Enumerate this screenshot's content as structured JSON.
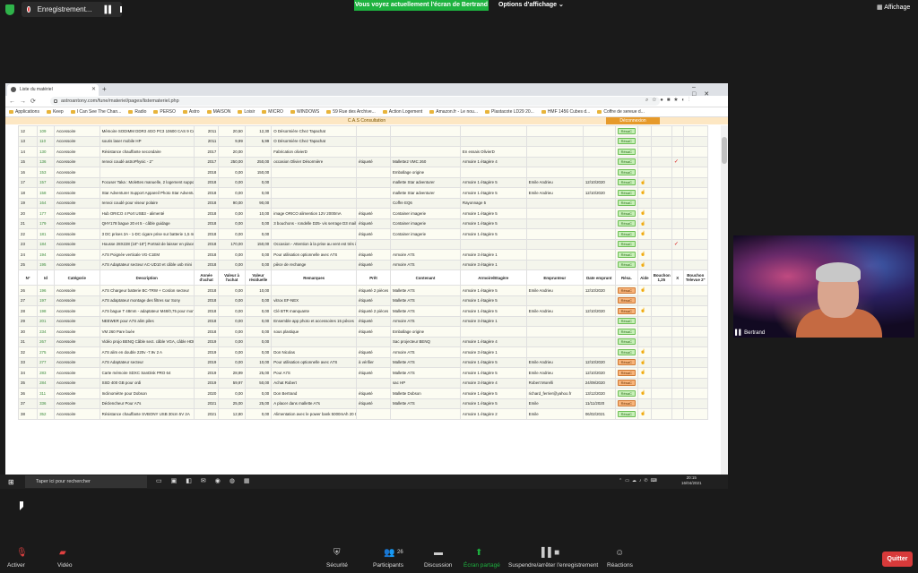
{
  "zoom": {
    "recording_label": "Enregistrement...",
    "share_banner": "Vous voyez actuellement l'écran de Bertrand",
    "view_options": "Options d'affichage ⌄",
    "display_label": "Affichage",
    "participant_name": "Bertrand",
    "participants_count": "26",
    "controls": {
      "mute": "Activer",
      "video": "Vidéo",
      "security": "Sécurité",
      "participants": "Participants",
      "chat": "Discussion",
      "share": "Écran partagé",
      "pause_share": "Suspendre/arrêter l'enregistrement",
      "reactions": "Réactions",
      "quit": "Quitter"
    }
  },
  "browser": {
    "tab_title": "Liste du matériel",
    "url": "astroantony.com/fune/materiel/pages/listemateriel.php",
    "bookmarks": [
      "Applications",
      "Keep",
      "I Can See The Chan...",
      "Radio",
      "PERSO",
      "Astro",
      "MAISON",
      "Loisir",
      "MICRO",
      "WINDOWS",
      "59 Rue des Archive...",
      "Action Logement",
      "Amazon.fr - Le nou...",
      "Plastacote LD29 20...",
      "HMF 1456 Cubes d...",
      "Coffre de sereue d..."
    ]
  },
  "page": {
    "title": "C.A.S Consultation",
    "disconnect": "Déconnexion",
    "headers": [
      "N°",
      "Id",
      "Catégorie",
      "Description",
      "Année d'achat",
      "Valeur à l'achat",
      "Valeur résiduelle",
      "Remarques",
      "Prêt",
      "Contenant",
      "Armoire/Etagère",
      "Emprunteur",
      "Date emprunt",
      "Résa.",
      "Aide",
      "Bouchon 1,25",
      "X",
      "Bouchon Televue 2\""
    ],
    "resa_label": "RésaC",
    "rows_top": [
      [
        "12",
        "109",
        "Accessoire",
        "Mémoire SODIMM DDR3 4GO PC3 10600 CAS 9 Crucial",
        "2011",
        "20,50",
        "12,30",
        "O Désormière Chez Tapachat",
        "",
        "",
        "",
        "",
        "",
        "g",
        "",
        "",
        "",
        ""
      ],
      [
        "13",
        "110",
        "Accessoire",
        "souris laser mobile HP",
        "2011",
        "9,99",
        "5,99",
        "O Désormière Chez Tapachat",
        "",
        "",
        "",
        "",
        "",
        "g",
        "",
        "",
        "",
        ""
      ],
      [
        "14",
        "130",
        "Accessoire",
        "Résistance chauffante secondaire",
        "2017",
        "20,00",
        "",
        "Fabrication olivierD",
        "",
        "",
        "En essais OlivierD",
        "",
        "",
        "g",
        "",
        "",
        "",
        ""
      ],
      [
        "15",
        "136",
        "Accessoire",
        "renvoi coudé astroPhysic - 2\"",
        "2017",
        "250,00",
        "250,00",
        "occasion Olivier Désormière",
        "étiqueté",
        "Mallette2 VMC 260",
        "Armoire 1 étagère 4",
        "",
        "",
        "g",
        "",
        "",
        "✓",
        ""
      ],
      [
        "16",
        "153",
        "Accessoire",
        "",
        "2018",
        "0,00",
        "150,00",
        "",
        "",
        "Emballage origine",
        "",
        "",
        "",
        "g",
        "",
        "",
        "",
        ""
      ],
      [
        "17",
        "157",
        "Accessoire",
        "Focuser Taka : Molettes manuelle, 2 logement supports, clés Allen",
        "2018",
        "0,00",
        "0,00",
        "",
        "",
        "mallette Star adventurer",
        "Armoire 1 étagère 5",
        "Emile Andrieu",
        "12/10/2020",
        "g",
        "h",
        "",
        "",
        ""
      ],
      [
        "18",
        "158",
        "Accessoire",
        "Star Adventurer Support Appareil Photo Star Adventurer Accessoires tige et un Contrepoids, 9 pièces + clé Allen",
        "2018",
        "0,00",
        "0,00",
        "",
        "",
        "mallette Star adventurer",
        "Armoire 1 étagère 5",
        "Emile Andrieu",
        "12/10/2020",
        "g",
        "h",
        "",
        "",
        ""
      ],
      [
        "19",
        "164",
        "Accessoire",
        "renvoi coudé pour viseur polaire",
        "2018",
        "90,00",
        "90,00",
        "",
        "",
        "Coffre EQ6",
        "Rayonnage 5",
        "",
        "",
        "g",
        "",
        "",
        "",
        ""
      ],
      [
        "20",
        "177",
        "Accessoire",
        "Hub ORICO 4 Port USB3 - alimenté",
        "2018",
        "0,00",
        "10,00",
        "image ORICO alimention 12V 2000mA",
        "étiqueté",
        "Container imagerie",
        "Armoire 1 étagère 5",
        "",
        "",
        "g",
        "h",
        "",
        "",
        ""
      ],
      [
        "21",
        "179",
        "Accessoire",
        "QHY178 bague 20 et 5 - câble guidage",
        "2018",
        "0,00",
        "0,00",
        "3 bouchons - rondelle D25- vis serrage D3 maille-2 bagues",
        "étiqueté",
        "Container imagerie",
        "Armoire 1 étagère 5",
        "",
        "",
        "g",
        "h",
        "",
        "",
        ""
      ],
      [
        "22",
        "181",
        "Accessoire",
        "3 DC prises 2A - 1-DC cigare prise sur batterie 1,5 mètre",
        "2018",
        "0,00",
        "0,00",
        "",
        "étiqueté",
        "Container imagerie",
        "Armoire 1 étagère 5",
        "",
        "",
        "g",
        "h",
        "",
        "",
        ""
      ],
      [
        "23",
        "184",
        "Accessoire",
        "Housse 28X228 (18\"-18\") Portrait de laisser en place monture et Tube",
        "2018",
        "170,00",
        "150,00",
        "Occasion - Attention à la prise au vent est très importante",
        "",
        "",
        "",
        "",
        "",
        "g",
        "",
        "",
        "✓",
        ""
      ],
      [
        "24",
        "194",
        "Accessoire",
        "A7S Poignée verticale VG-C1EM",
        "2018",
        "0,00",
        "0,00",
        "Pour utilisation optionnelle avec A7S",
        "étiqueté",
        "Armoire A7S",
        "Armoire 3 étagère 1",
        "",
        "",
        "g",
        "h",
        "",
        "",
        ""
      ],
      [
        "25",
        "195",
        "Accessoire",
        "A7S Adaptateur secteur AC-UD10 et câble usb mini",
        "2018",
        "0,00",
        "0,00",
        "pièce de rechange",
        "étiqueté",
        "Armoire A7S",
        "Armoire 3 étagère 1",
        "",
        "",
        "g",
        "h",
        "",
        "",
        ""
      ]
    ],
    "rows_bottom": [
      [
        "26",
        "196",
        "Accessoire",
        "A7S Chargeur batterie BC-TRW + Cordon secteur",
        "2018",
        "0,00",
        "10,00",
        "",
        "étiqueté 2 pièces",
        "Mallette A7S",
        "Armoire 1 étagère 5",
        "Emile Andrieu",
        "12/10/2020",
        "o",
        "h",
        "",
        "",
        ""
      ],
      [
        "27",
        "197",
        "Accessoire",
        "A7S adaptateur montage des filtres sur Sony",
        "2018",
        "0,00",
        "0,00",
        "vitrox EF-NEX",
        "étiqueté",
        "Mallette A7S",
        "Armoire 1 étagère 5",
        "",
        "",
        "o",
        "",
        "",
        "",
        ""
      ],
      [
        "28",
        "198",
        "Accessoire",
        "A7S bague T 48mm - adaptateur M48/0,75 pour montage télescope + clé BTR",
        "2018",
        "0,00",
        "0,00",
        "Clé BTR manquante",
        "étiqueté 2 pièces",
        "Mallette A7S",
        "Armoire 1 étagère 5",
        "Emile Andrieu",
        "12/10/2020",
        "o",
        "h",
        "",
        "",
        ""
      ],
      [
        "29",
        "201",
        "Accessoire",
        "NEEWER pour A7S alim piles",
        "2018",
        "0,00",
        "0,00",
        "Ensemble app photo et accessoires 15 pièces",
        "étiqueté",
        "Armoire A7S",
        "Armoire 3 étagère 1",
        "",
        "",
        "g",
        "",
        "",
        "",
        ""
      ],
      [
        "30",
        "234",
        "Accessoire",
        "VM 260 Pare buée",
        "2018",
        "0,00",
        "0,00",
        "sous plastique",
        "étiqueté",
        "Emballage origine",
        "",
        "",
        "",
        "g",
        "",
        "",
        "",
        ""
      ],
      [
        "31",
        "267",
        "Accessoire",
        "Vidéo projo BENQ Câble sect. câble VGA, câble HDMI, télécommande pointeur laser",
        "2019",
        "0,00",
        "0,00",
        "",
        "",
        "Sac projecteur BENQ",
        "Armoire 1 étagère 4",
        "",
        "",
        "g",
        "",
        "",
        "",
        ""
      ],
      [
        "32",
        "275",
        "Accessoire",
        "A7S alim en double 220v -7.9v 2 A",
        "2019",
        "0,00",
        "0,00",
        "Don Nicolas",
        "étiqueté",
        "Armoire A7S",
        "Armoire 3 étagère 1",
        "",
        "",
        "g",
        "h",
        "",
        "",
        ""
      ],
      [
        "33",
        "277",
        "Accessoire",
        "A7S Adaptateur secteur",
        "2019",
        "0,00",
        "10,00",
        "Pour utilisation optionnelle avec A7S",
        "à vérifier",
        "Mallette A7S",
        "Armoire 1 étagère 5",
        "Emile Andrieu",
        "12/10/2020",
        "o",
        "h",
        "",
        "",
        ""
      ],
      [
        "34",
        "283",
        "Accessoire",
        "Carte mémoire SDXC SanDisk PRO 64",
        "2019",
        "28,99",
        "25,00",
        "Pour A7S",
        "étiqueté",
        "Mallette A7S",
        "Armoire 1 étagère 5",
        "Emile Andrieu",
        "12/10/2020",
        "o",
        "h",
        "",
        "",
        ""
      ],
      [
        "35",
        "284",
        "Accessoire",
        "SSD 400 GB pour ordi",
        "2019",
        "59,97",
        "50,00",
        "Achat Robert",
        "",
        "sac HP",
        "Armoire 3 étagère 4",
        "Robert Morelli",
        "24/09/2020",
        "o",
        "",
        "",
        "",
        ""
      ],
      [
        "36",
        "311",
        "Accessoire",
        "Inclinomètre pour Dobson",
        "2020",
        "0,00",
        "0,00",
        "Don Bertrand",
        "étiqueté",
        "Mallette Dobson",
        "Armoire 1 étagère 5",
        "richard_ferrier@yahoo.fr",
        "13/12/2020",
        "g",
        "h",
        "",
        "",
        ""
      ],
      [
        "37",
        "336",
        "Accessoire",
        "Déclencheur Pour A7s",
        "2021",
        "25,00",
        "25,00",
        "A placer dans mallette A7s",
        "étiqueté",
        "Mallette A7S",
        "Armoire 1 étagère 5",
        "Emile",
        "11/11/2020",
        "o",
        "",
        "",
        "",
        ""
      ],
      [
        "38",
        "352",
        "Accessoire",
        "Résistance chauffante SVBONY USB 30cm 5V 2A",
        "2021",
        "12,80",
        "0,00",
        "Alimentation avec le power bank 5000mAh 20 000mAh",
        "",
        "",
        "Armoire 1 étagère 2",
        "Emile",
        "06/02/2021",
        "g",
        "h",
        "",
        "",
        ""
      ]
    ]
  },
  "taskbar": {
    "search_placeholder": "Taper ici pour rechercher",
    "time": "20:15",
    "date": "16/04/2021"
  }
}
